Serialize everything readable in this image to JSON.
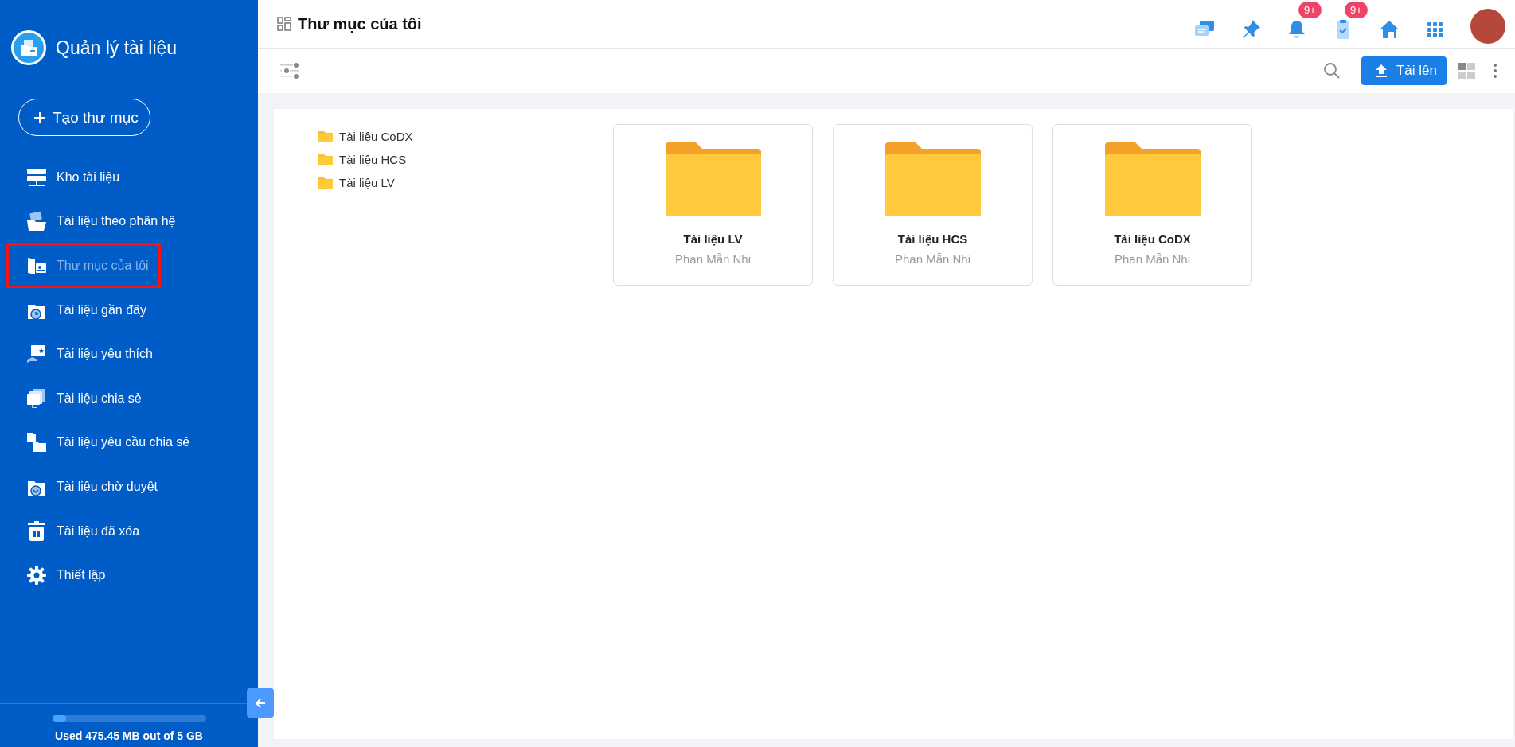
{
  "sidebar": {
    "app_title": "Quản lý tài liệu",
    "create_button": "Tạo thư mục",
    "items": [
      {
        "label": "Kho tài liệu",
        "selected": false
      },
      {
        "label": "Tài liệu theo phân hệ",
        "selected": false
      },
      {
        "label": "Thư mục của tôi",
        "selected": true
      },
      {
        "label": "Tài liệu gần đây",
        "selected": false
      },
      {
        "label": "Tài liệu yêu thích",
        "selected": false
      },
      {
        "label": "Tài liệu chia sẻ",
        "selected": false
      },
      {
        "label": "Tài liệu yêu cầu chia sẻ",
        "selected": false
      },
      {
        "label": "Tài liệu chờ duyệt",
        "selected": false
      },
      {
        "label": "Tài liệu đã xóa",
        "selected": false
      },
      {
        "label": "Thiết lập",
        "selected": false
      }
    ],
    "storage": {
      "level": 0.093,
      "text": "Used 475.45 MB out of 5 GB"
    }
  },
  "header": {
    "title": "Thư mục của tôi",
    "icons": [
      {
        "kind": "chat"
      },
      {
        "kind": "pin"
      },
      {
        "kind": "bell",
        "badge": "9+"
      },
      {
        "kind": "clipboard",
        "badge": "9+"
      },
      {
        "kind": "home"
      },
      {
        "kind": "apps"
      }
    ]
  },
  "toolbar": {
    "upload_button": "Tải lên"
  },
  "tree": [
    {
      "label": "Tài liệu CoDX"
    },
    {
      "label": "Tài liệu HCS"
    },
    {
      "label": "Tài liệu LV"
    }
  ],
  "folders": [
    {
      "name": "Tài liệu LV",
      "owner": "Phan Mẫn Nhi"
    },
    {
      "name": "Tài liệu HCS",
      "owner": "Phan Mẫn Nhi"
    },
    {
      "name": "Tài liệu CoDX",
      "owner": "Phan Mẫn Nhi"
    }
  ]
}
